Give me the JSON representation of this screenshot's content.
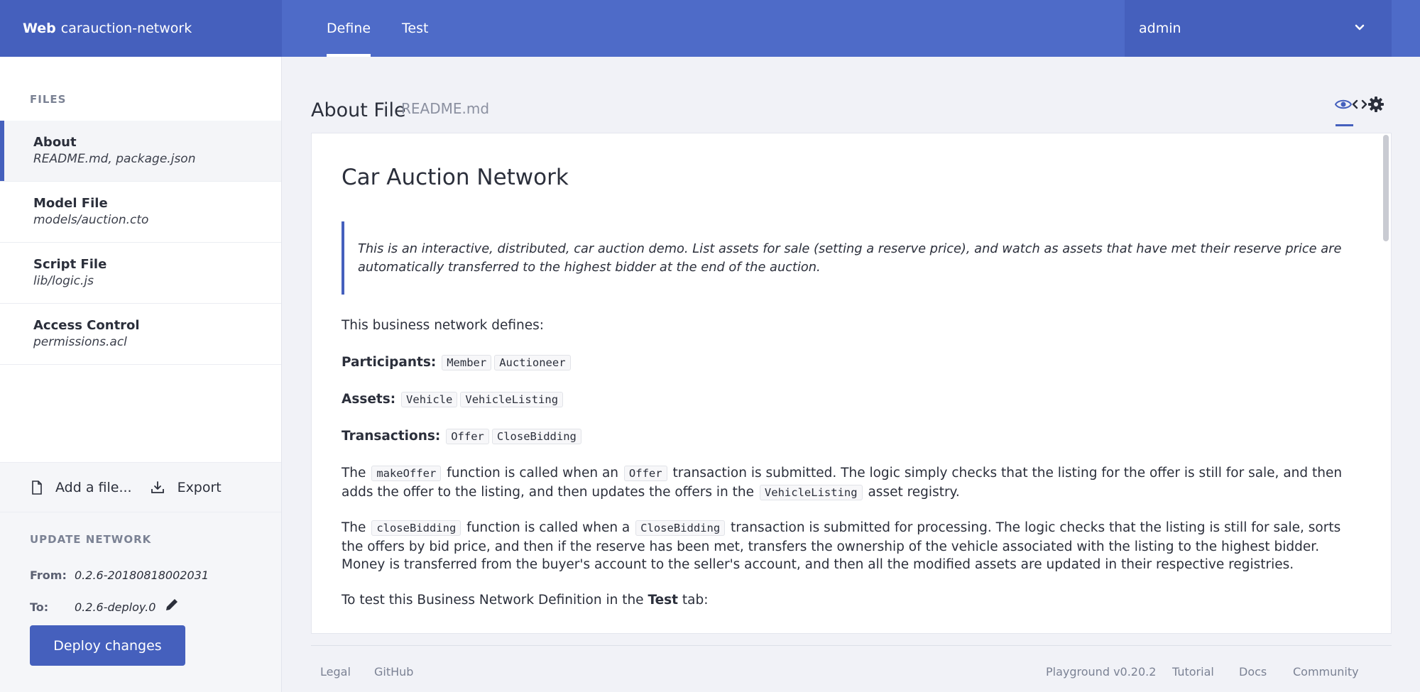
{
  "header": {
    "brand_bold": "Web",
    "brand_name": "carauction-network",
    "tabs": [
      {
        "label": "Define",
        "active": true
      },
      {
        "label": "Test",
        "active": false
      }
    ],
    "user": "admin"
  },
  "sidebar": {
    "files_heading": "FILES",
    "files": [
      {
        "name": "About",
        "path": "README.md, package.json",
        "active": true
      },
      {
        "name": "Model File",
        "path": "models/auction.cto"
      },
      {
        "name": "Script File",
        "path": "lib/logic.js"
      },
      {
        "name": "Access Control",
        "path": "permissions.acl"
      }
    ],
    "add_file_label": "Add a file...",
    "export_label": "Export",
    "update_heading": "UPDATE NETWORK",
    "from_label": "From:",
    "from_value": "0.2.6-20180818002031",
    "to_label": "To:",
    "to_value": "0.2.6-deploy.0",
    "deploy_label": "Deploy changes"
  },
  "main": {
    "title": "About File",
    "subtitle": "README.md",
    "doc": {
      "heading": "Car Auction Network",
      "quote": "This is an interactive, distributed, car auction demo. List assets for sale (setting a reserve price), and watch as assets that have met their reserve price are automatically transferred to the highest bidder at the end of the auction.",
      "intro": "This business network defines:",
      "participants_label": "Participants:",
      "participants": [
        "Member",
        "Auctioneer"
      ],
      "assets_label": "Assets:",
      "assets": [
        "Vehicle",
        "VehicleListing"
      ],
      "transactions_label": "Transactions:",
      "transactions": [
        "Offer",
        "CloseBidding"
      ],
      "p1": {
        "t1": "The",
        "c1": "makeOffer",
        "t2": "function is called when an",
        "c2": "Offer",
        "t3": "transaction is submitted. The logic simply checks that the listing for the offer is still for sale, and then adds the offer to the listing, and then updates the offers in the",
        "c3": "VehicleListing",
        "t4": "asset registry."
      },
      "p2": {
        "t1": "The",
        "c1": "closeBidding",
        "t2": "function is called when a",
        "c2": "CloseBidding",
        "t3": "transaction is submitted for processing. The logic checks that the listing is still for sale, sorts the offers by bid price, and then if the reserve has been met, transfers the ownership of the vehicle associated with the listing to the highest bidder. Money is transferred from the buyer's account to the seller's account, and then all the modified assets are updated in their respective registries."
      },
      "p3": {
        "t1": "To test this Business Network Definition in the",
        "b1": "Test",
        "t2": "tab:"
      }
    }
  },
  "footer": {
    "left": [
      "Legal",
      "GitHub"
    ],
    "version": "Playground v0.20.2",
    "right": [
      "Tutorial",
      "Docs",
      "Community"
    ]
  },
  "colors": {
    "primary": "#4560bd",
    "topbar": "#4e6bc8",
    "background": "#f1f2f7"
  }
}
